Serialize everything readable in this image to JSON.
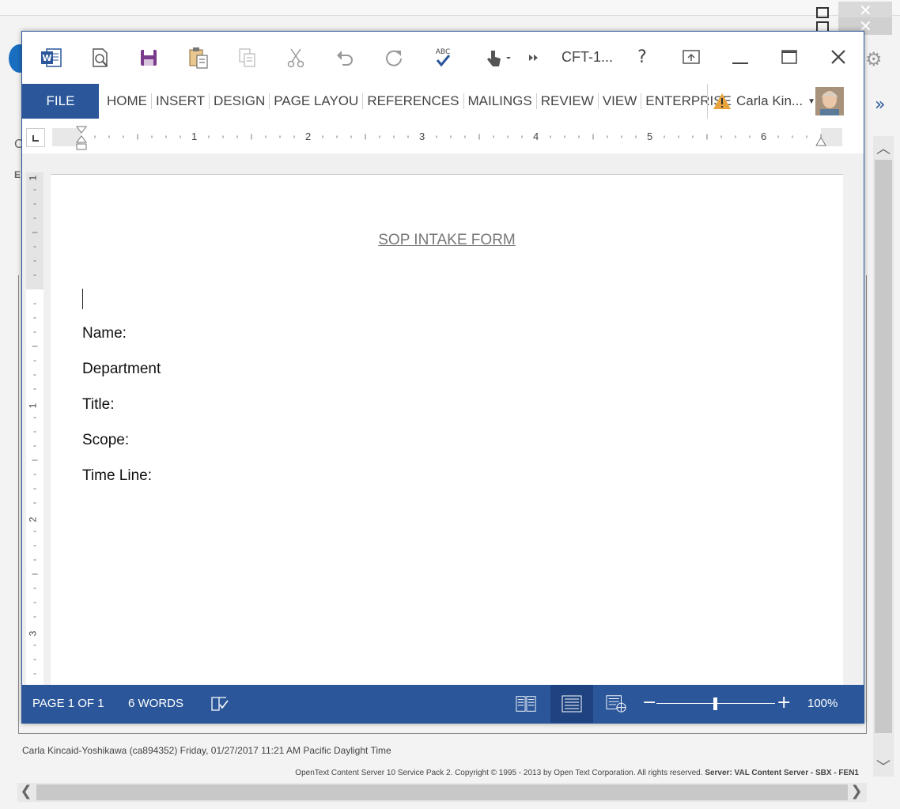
{
  "word": {
    "title": "CFT-1...",
    "help_label": "?",
    "tabs": {
      "file": "FILE",
      "items": [
        "HOME",
        "INSERT",
        "DESIGN",
        "PAGE LAYOU",
        "REFERENCES",
        "MAILINGS",
        "REVIEW",
        "VIEW",
        "ENTERPRISE"
      ]
    },
    "user": {
      "name": "Carla Kin..."
    },
    "ruler": {
      "h_numbers": [
        "1",
        "2",
        "3",
        "4",
        "5",
        "6"
      ],
      "v_numbers": [
        "1",
        "1",
        "2",
        "3"
      ]
    },
    "document": {
      "heading": "SOP INTAKE FORM",
      "fields": [
        "Name:",
        "Department",
        "Title:",
        "Scope:",
        "Time Line:"
      ]
    },
    "status": {
      "page": "PAGE 1 OF 1",
      "words": "6 WORDS",
      "zoom_label": "100%",
      "zoom_level_percent": 100
    }
  },
  "background": {
    "user_line": "Carla Kincaid-Yoshikawa (ca894352)    Friday, 01/27/2017 11:21 AM Pacific Daylight Time",
    "copyright": "OpenText Content Server 10 Service Pack 2. Copyright © 1995 - 2013 by Open Text Corporation. All rights reserved.",
    "server": "Server: VAL Content Server - SBX - FEN1",
    "letters": [
      "C",
      "E"
    ]
  },
  "colors": {
    "accent": "#2b579a",
    "status_bar": "#2b579a"
  }
}
